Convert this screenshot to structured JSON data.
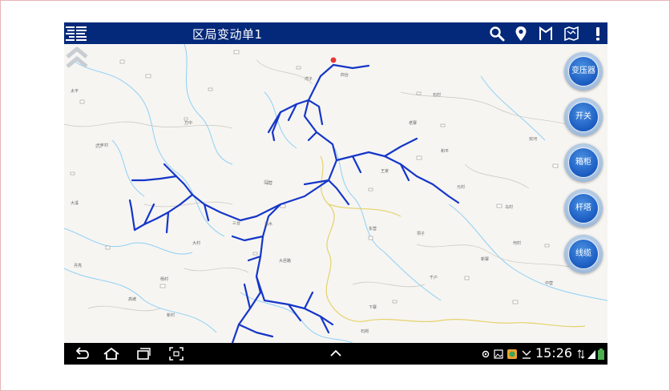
{
  "app": {
    "title": "区局变动单1"
  },
  "toolbar": {
    "icons": [
      "search-icon",
      "location-pin-icon",
      "flag-icon",
      "map-icon",
      "alert-icon"
    ]
  },
  "side_buttons": [
    {
      "label": "变压器"
    },
    {
      "label": "开关"
    },
    {
      "label": "箱柜"
    },
    {
      "label": "杆塔"
    },
    {
      "label": "线缆"
    }
  ],
  "map": {
    "labels": [
      "大丰村",
      "大村",
      "大溪",
      "万中",
      "王家",
      "四台",
      "马营",
      "东营",
      "杨村",
      "石村",
      "乌村",
      "老寨",
      "下寨",
      "元村",
      "中营",
      "新寨",
      "大邑路",
      "千户",
      "湾子",
      "月亮",
      "高坡",
      "坝子",
      "清水",
      "和平",
      "太平",
      "三台",
      "何村",
      "石岗",
      "新村",
      "双河"
    ],
    "line_color": "#1536c8",
    "marker_color": "#e53935"
  },
  "navbar": {
    "time": "15:26",
    "icons": [
      "back-icon",
      "home-icon",
      "recent-apps-icon",
      "screenshot-icon",
      "up-chevron-icon"
    ]
  }
}
